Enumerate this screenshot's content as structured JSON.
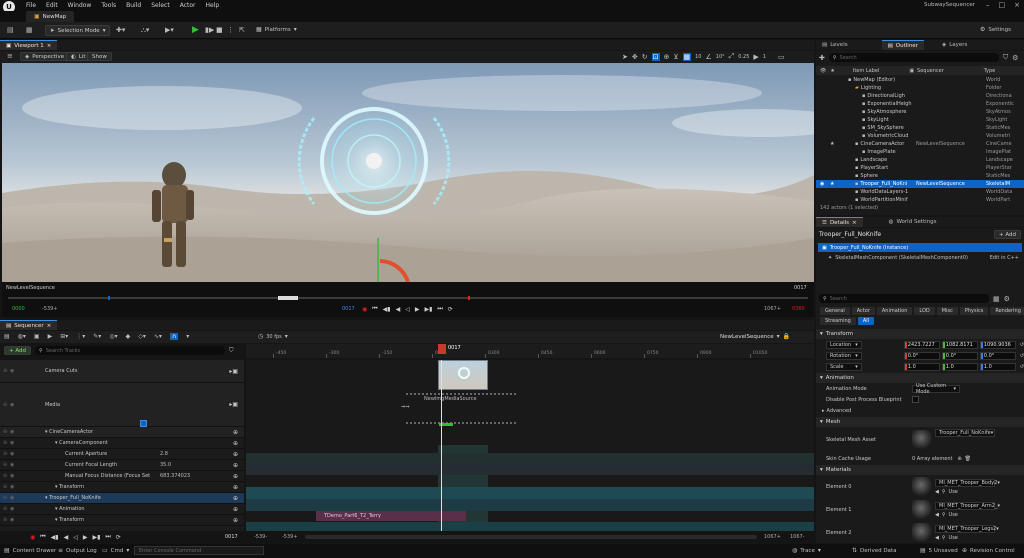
{
  "menu": [
    "File",
    "Edit",
    "Window",
    "Tools",
    "Build",
    "Select",
    "Actor",
    "Help"
  ],
  "app_title": "SubwaySequencer",
  "map_tab": "NewMap",
  "toolbar": {
    "selection_mode": "Selection Mode",
    "platforms": "Platforms",
    "settings": "Settings"
  },
  "viewport": {
    "tab": "Viewport 1",
    "perspective": "Perspective",
    "lit": "Lit",
    "show": "Show",
    "grid_value": "10",
    "rot_value": "10°",
    "scale_value": "0.25",
    "cam_value": "1",
    "sequence_name": "NewLevelSequence",
    "frame_right": "0017",
    "time_start": "0000",
    "time_in": "-539+",
    "time_cur": "0017",
    "time_out": "1067+",
    "time_end": "0360"
  },
  "outliner": {
    "tabs": [
      "Levels",
      "Outliner",
      "Layers"
    ],
    "search_placeholder": "Search",
    "col_label": "Item Label",
    "col_sequencer": "Sequencer",
    "col_type": "Type",
    "rows": [
      {
        "label": "NewMap (Editor)",
        "seq": "",
        "type": "World",
        "indent": 0,
        "sel": false
      },
      {
        "label": "Lighting",
        "seq": "",
        "type": "Folder",
        "indent": 1,
        "sel": false
      },
      {
        "label": "DirectionalLigh",
        "seq": "",
        "type": "Directiona",
        "indent": 2,
        "sel": false
      },
      {
        "label": "ExponentialHeigh",
        "seq": "",
        "type": "Exponentic",
        "indent": 2,
        "sel": false
      },
      {
        "label": "SkyAtmosphere",
        "seq": "",
        "type": "SkyAtmos",
        "indent": 2,
        "sel": false
      },
      {
        "label": "SkyLight",
        "seq": "",
        "type": "SkyLight",
        "indent": 2,
        "sel": false
      },
      {
        "label": "SM_SkySphere",
        "seq": "",
        "type": "StaticMes",
        "indent": 2,
        "sel": false
      },
      {
        "label": "VolumetricCloud",
        "seq": "",
        "type": "Volumetri",
        "indent": 2,
        "sel": false
      },
      {
        "label": "CineCameraActor",
        "seq": "NewLevelSequence",
        "type": "CineCame",
        "indent": 1,
        "sel": false
      },
      {
        "label": "ImagePlate",
        "seq": "",
        "type": "ImagePlat",
        "indent": 2,
        "sel": false
      },
      {
        "label": "Landscape",
        "seq": "",
        "type": "Landscape",
        "indent": 1,
        "sel": false
      },
      {
        "label": "PlayerStart",
        "seq": "",
        "type": "PlayerStar",
        "indent": 1,
        "sel": false
      },
      {
        "label": "Sphere",
        "seq": "",
        "type": "StaticMes",
        "indent": 1,
        "sel": false
      },
      {
        "label": "Trooper_Full_NoKni",
        "seq": "NewLevelSequence",
        "type": "SkeletalM",
        "indent": 1,
        "sel": true
      },
      {
        "label": "WorldDataLayers-1",
        "seq": "",
        "type": "WorldData",
        "indent": 1,
        "sel": false
      },
      {
        "label": "WorldPartitionMinif",
        "seq": "",
        "type": "WorldPart",
        "indent": 1,
        "sel": false
      }
    ],
    "footer": "142 actors (1 selected)"
  },
  "details": {
    "tabs": [
      "Details",
      "World Settings"
    ],
    "actor_name": "Trooper_Full_NoKnife",
    "add_label": "+ Add",
    "instance_label": "Trooper_Full_NoKnife (Instance)",
    "component_label": "SkeletalMeshComponent (SkeletalMeshComponent0)",
    "edit_cpp": "Edit in C++",
    "search_placeholder": "Search",
    "filters_row1": [
      "General",
      "Actor",
      "Animation",
      "LOD",
      "Misc",
      "Physics",
      "Rendering"
    ],
    "filters_row2": [
      "Streaming",
      "All"
    ],
    "transform_header": "Transform",
    "location_label": "Location",
    "rotation_label": "Rotation",
    "scale_label": "Scale",
    "location": [
      "2423.7227",
      "1082.8171",
      "1090.9036"
    ],
    "rotation": [
      "0.0°",
      "0.0°",
      "0.0°"
    ],
    "scale": [
      "1.0",
      "1.0",
      "1.0"
    ],
    "animation_header": "Animation",
    "anim_mode_label": "Animation Mode",
    "anim_mode_value": "Use Custom Mode",
    "disable_pp_label": "Disable Post Process Blueprint",
    "advanced_label": "Advanced",
    "mesh_header": "Mesh",
    "skm_asset_label": "Skeletal Mesh Asset",
    "skm_asset_value": "Trooper_Full_NoKnife",
    "skin_cache_label": "Skin Cache Usage",
    "skin_cache_value": "0 Array element",
    "materials_header": "Materials",
    "elements": [
      {
        "label": "Element 0",
        "value": "MI_MET_Trooper_Body2"
      },
      {
        "label": "Element 1",
        "value": "MI_MET_Trooper_Arm2_"
      },
      {
        "label": "Element 2",
        "value": "MI_MET_Trooper_Legs2"
      }
    ],
    "use_label": "Use"
  },
  "sequencer": {
    "tab": "Sequencer",
    "fps": "30 fps",
    "sequence_name": "NewLevelSequence",
    "add_label": "+ Add",
    "search_placeholder": "Search Tracks",
    "playhead": "0017",
    "ruler": [
      "-450",
      "-300",
      "-150",
      "0150",
      "0300",
      "0450",
      "0600",
      "0750",
      "0900",
      "01050"
    ],
    "tracks": [
      {
        "label": "Camera Cuts",
        "indent": 0
      },
      {
        "label": "Media",
        "indent": 0
      },
      {
        "label": "CineCameraActor",
        "indent": 0
      },
      {
        "label": "CameraComponent",
        "indent": 1
      },
      {
        "label": "Current Aperture",
        "indent": 2,
        "value": "2.8"
      },
      {
        "label": "Current Focal Length",
        "indent": 2,
        "value": "35.0"
      },
      {
        "label": "Manual Focus Distance (Focus Set",
        "indent": 2,
        "value": "683.374023"
      },
      {
        "label": "Transform",
        "indent": 1
      },
      {
        "label": "Trooper_Full_NoKnife",
        "indent": 0
      },
      {
        "label": "Animation",
        "indent": 1
      },
      {
        "label": "Transform",
        "indent": 1
      }
    ],
    "media_label": "NewImgMediaSource",
    "anim_clip": "TDemo_Part6_T2_Terry",
    "bottom_start": "-539-",
    "bottom_in": "-539+",
    "bottom_cur": "0017",
    "bottom_out": "1067+",
    "bottom_end": "1067-"
  },
  "statusbar": {
    "content_drawer": "Content Drawer",
    "output_log": "Output Log",
    "cmd": "Cmd",
    "console_placeholder": "Enter Console Command",
    "trace": "Trace",
    "derived_data": "Derived Data",
    "unsaved": "5 Unsaved",
    "revision": "Revision Control"
  },
  "colors": {
    "accent": "#0e63c7",
    "record": "#e02020",
    "play": "#2fbf3a"
  }
}
